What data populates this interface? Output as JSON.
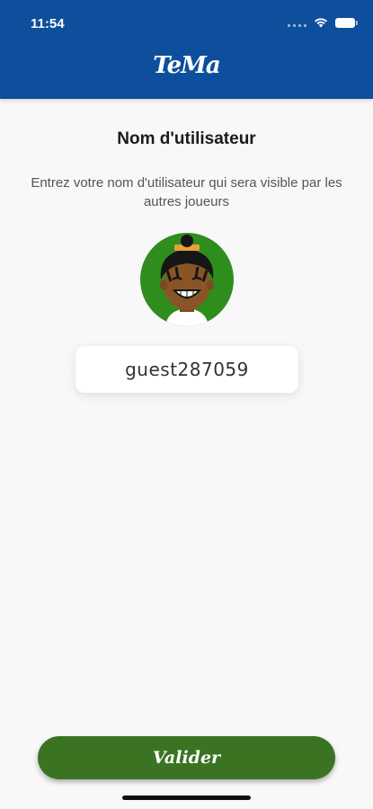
{
  "status_bar": {
    "time": "11:54",
    "icons": [
      "cellular-signal-icon",
      "wifi-icon",
      "battery-icon"
    ]
  },
  "header": {
    "logo_text": "TeMa"
  },
  "main": {
    "title": "Nom d'utilisateur",
    "subtitle": "Entrez votre nom d'utilisateur qui sera visible par les autres joueurs",
    "avatar": "laughing-character-avatar",
    "username_value": "guest287059"
  },
  "footer": {
    "validate_label": "Valider"
  },
  "colors": {
    "header_bg": "#0d4f9c",
    "button_bg": "#3a7423",
    "avatar_bg": "#2f8d1e",
    "page_bg": "#f8f8f8"
  }
}
